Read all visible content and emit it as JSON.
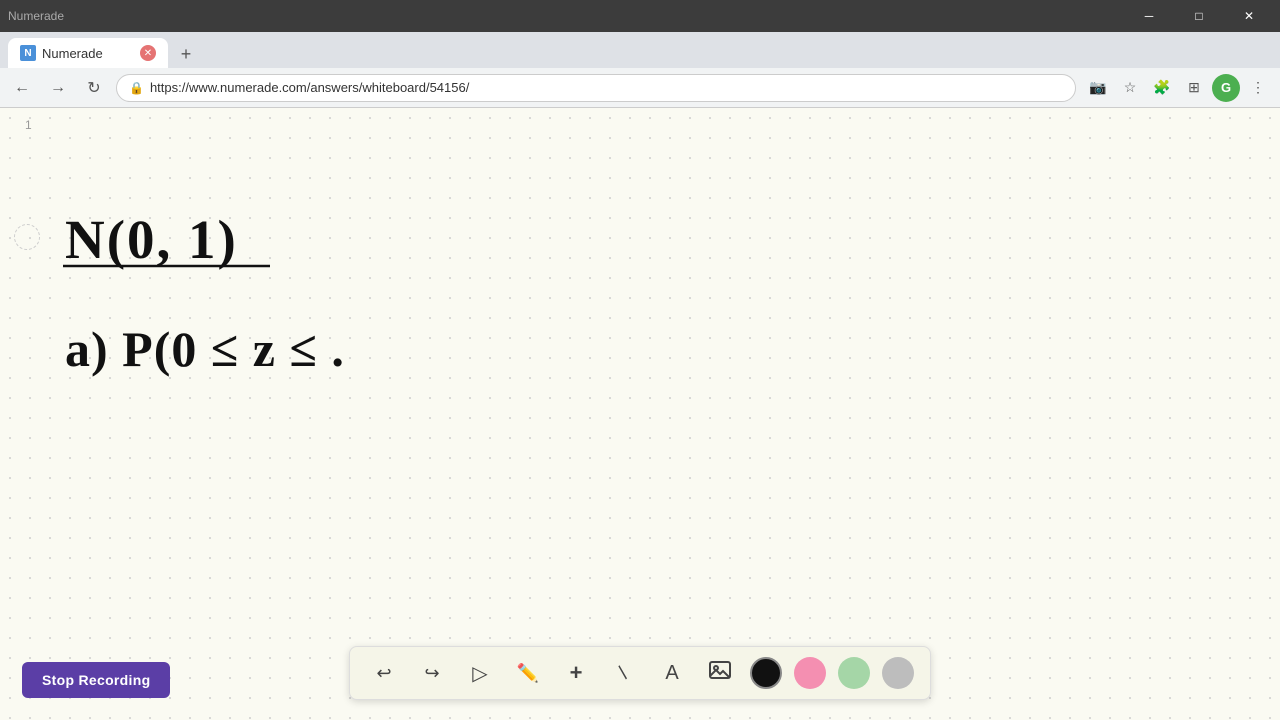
{
  "browser": {
    "tab_title": "Numerade",
    "tab_favicon": "N",
    "url": "https://www.numerade.com/answers/whiteboard/54156/",
    "nav_buttons": {
      "back": "←",
      "forward": "→",
      "reload": "↻"
    }
  },
  "window_controls": {
    "minimize": "─",
    "maximize": "□",
    "close": "✕"
  },
  "whiteboard": {
    "page_number": "1",
    "math_line1": "N(0, 1)",
    "math_line2": "a)  P(0 ≤ z ≤ ."
  },
  "toolbar": {
    "undo_label": "↩",
    "redo_label": "↪",
    "select_label": "▷",
    "pen_label": "✏",
    "add_label": "+",
    "eraser_label": "/",
    "text_label": "A",
    "image_label": "🖼",
    "colors": {
      "black": "#111111",
      "pink": "#f48fb1",
      "green": "#a5d6a7",
      "gray": "#bdbdbd"
    }
  },
  "stop_recording": {
    "label": "Stop Recording"
  }
}
